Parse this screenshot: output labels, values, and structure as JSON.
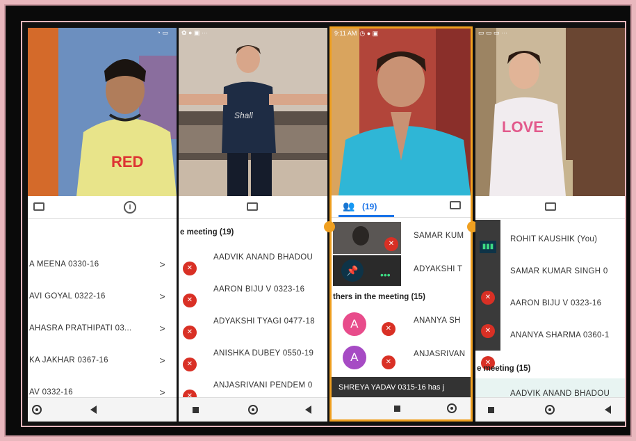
{
  "panel1": {
    "items": [
      {
        "label": "A MEENA 0330-16"
      },
      {
        "label": "AVI GOYAL 0322-16"
      },
      {
        "label": "AHASRA PRATHIPATI 03..."
      },
      {
        "label": "KA JAKHAR 0367-16"
      },
      {
        "label": "AV 0332-16"
      }
    ],
    "chevron": ">"
  },
  "panel2": {
    "header": "e meeting (19)",
    "items": [
      {
        "label": "AADVIK ANAND BHADOU"
      },
      {
        "label": "AARON BIJU V 0323-16"
      },
      {
        "label": "ADYAKSHI TYAGI 0477-18"
      },
      {
        "label": "ANISHKA DUBEY 0550-19"
      },
      {
        "label": "ANJASRIVANI PENDEM 0"
      }
    ]
  },
  "panel3": {
    "status_time": "9:11 AM",
    "people_count": "(19)",
    "pinned": [
      {
        "label": "SAMAR KUM"
      },
      {
        "label": "ADYAKSHI T"
      }
    ],
    "header": "thers in the meeting (15)",
    "others": [
      {
        "avatar": "A",
        "label": "ANANYA SH"
      },
      {
        "avatar": "A",
        "label": "ANJASRIVAN"
      }
    ],
    "toast": "SHREYA YADAV 0315-16 has j",
    "colors": {
      "accent": "#f0a020",
      "avatar1": "#e84c8b",
      "avatar2": "#a64bc4"
    }
  },
  "panel4": {
    "items": [
      {
        "label": "ROHIT KAUSHIK (You)"
      },
      {
        "label": "SAMAR KUMAR SINGH 0"
      },
      {
        "label": "AARON BIJU V 0323-16"
      },
      {
        "label": "ANANYA SHARMA 0360-1"
      }
    ],
    "header": "e meeting (15)",
    "highlight": {
      "label": "AADVIK ANAND BHADOU"
    }
  },
  "icons": {
    "mic_off": "mic-off-icon",
    "chat": "chat-icon",
    "info": "info-icon",
    "people": "people-icon"
  }
}
